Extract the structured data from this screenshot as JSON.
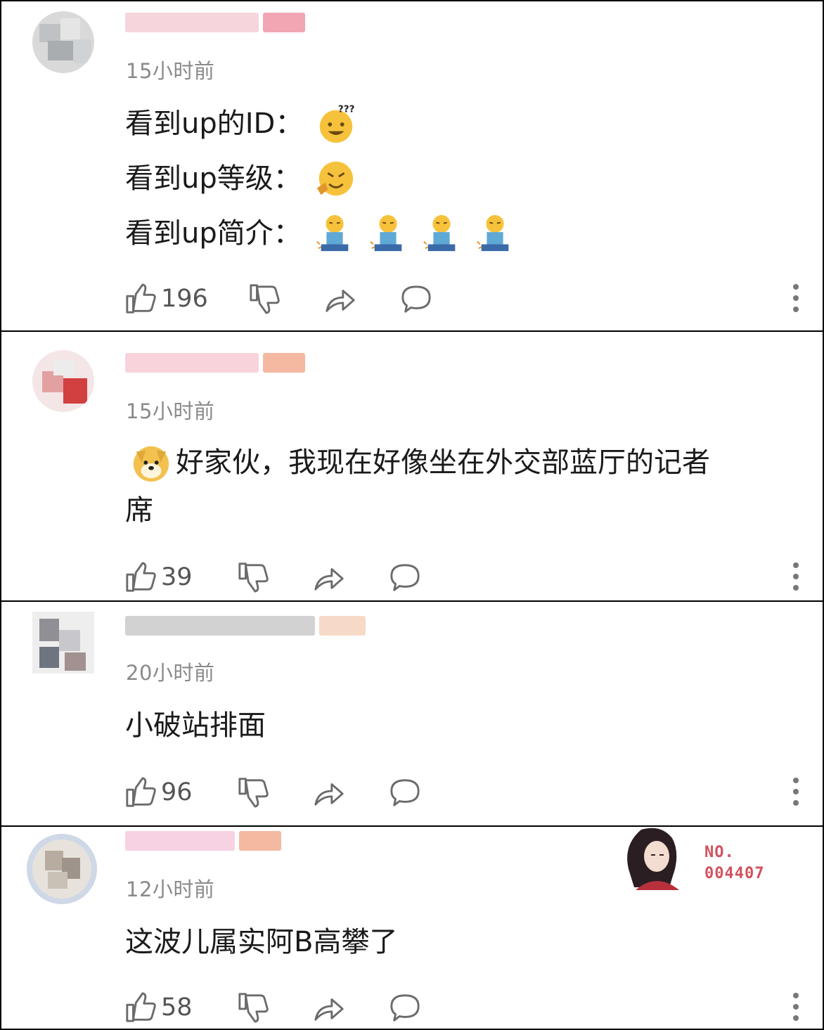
{
  "comments": [
    {
      "time": "15小时前",
      "lines": [
        {
          "text": "看到up的ID：",
          "emojis": [
            "thinking-face-emoji"
          ]
        },
        {
          "text": "看到up等级：",
          "emojis": [
            "laughing-face-emoji"
          ]
        },
        {
          "text": "看到up简介：",
          "emojis": [
            "sitting-person-emoji",
            "sitting-person-emoji",
            "sitting-person-emoji",
            "sitting-person-emoji"
          ]
        }
      ],
      "likes": "196"
    },
    {
      "time": "15小时前",
      "text_line1": "好家伙，我现在好像坐在外交部蓝厅的记者",
      "text_line2": "席",
      "likes": "39"
    },
    {
      "time": "20小时前",
      "text": "小破站排面",
      "likes": "96"
    },
    {
      "time": "12小时前",
      "text": "这波儿属实阿B高攀了",
      "likes": "58",
      "badge": {
        "line1": "NO.",
        "line2": "004407"
      }
    }
  ],
  "colors": {
    "time": "#8a8a8a",
    "icon": "#6b6b6b",
    "badge": "#d2525f"
  }
}
